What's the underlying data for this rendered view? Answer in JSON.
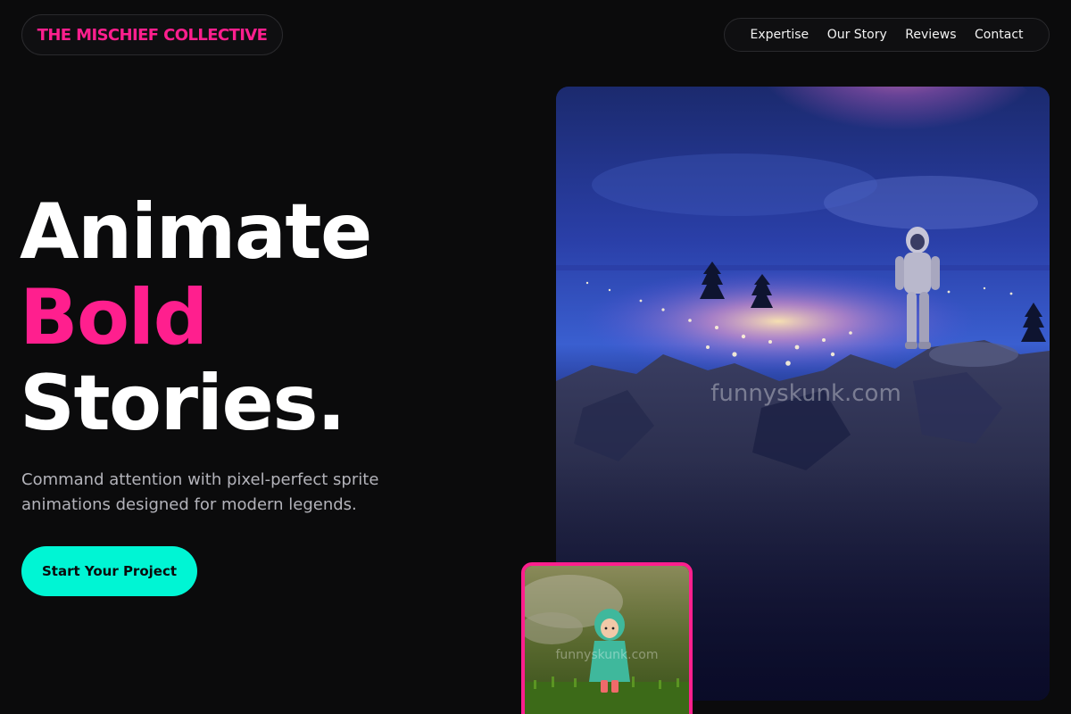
{
  "brand": {
    "name": "THE MISCHIEF COLLECTIVE",
    "accent_color": "#ff1f8e",
    "cta_color": "#00f5d4"
  },
  "nav": {
    "items": [
      {
        "label": "Expertise"
      },
      {
        "label": "Our Story"
      },
      {
        "label": "Reviews"
      },
      {
        "label": "Contact"
      }
    ]
  },
  "hero": {
    "headline_line1": "Animate",
    "headline_line2": "Bold",
    "headline_line3": "Stories.",
    "subtitle": "Command attention with pixel-perfect sprite animations designed for modern legends.",
    "cta_label": "Start Your Project"
  },
  "images": {
    "main_watermark": "funnyskunk.com",
    "thumb_watermark": "funnyskunk.com"
  }
}
